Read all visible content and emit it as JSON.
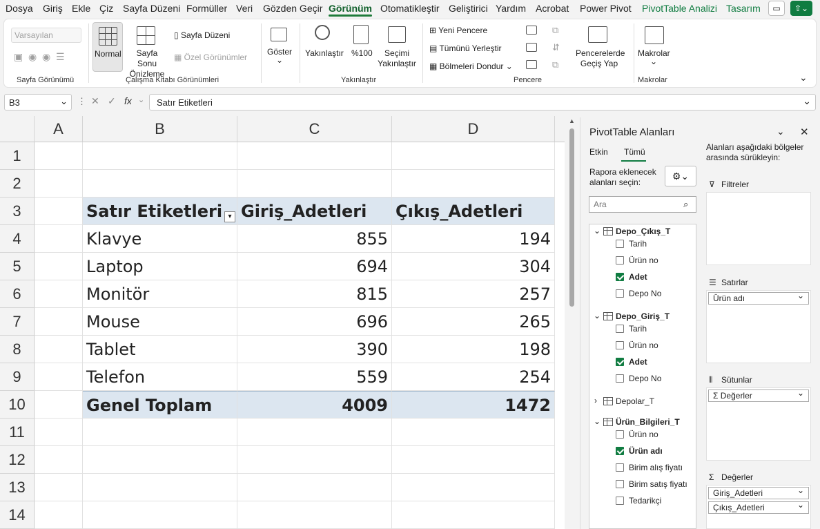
{
  "menu": {
    "tabs": [
      "Dosya",
      "Giriş",
      "Ekle",
      "Çiz",
      "Sayfa Düzeni",
      "Formüller",
      "Veri",
      "Gözden Geçir",
      "Görünüm",
      "Otomatikleştir",
      "Geliştirici",
      "Yardım",
      "Acrobat",
      "Power Pivot",
      "PivotTable Analizi",
      "Tasarım"
    ],
    "active": "Görünüm"
  },
  "ribbon": {
    "sheet_view": {
      "dropdown": "Varsayılan",
      "label": "Sayfa Görünümü"
    },
    "workbook_views": {
      "normal": "Normal",
      "page_break": "Sayfa Sonu Önizleme",
      "page_layout": "Sayfa Düzeni",
      "custom": "Özel Görünümler",
      "label": "Çalışma Kitabı Görünümleri"
    },
    "show": {
      "label": "Göster"
    },
    "zoom": {
      "zoom": "Yakınlaştır",
      "hundred": "%100",
      "selection": "Seçimi Yakınlaştır",
      "label": "Yakınlaştır"
    },
    "window": {
      "new": "Yeni Pencere",
      "arrange": "Tümünü Yerleştir",
      "freeze": "Bölmeleri Dondur",
      "switch": "Pencerelerde Geçiş Yap",
      "label": "Pencere"
    },
    "macros": {
      "label": "Makrolar",
      "button": "Makrolar"
    }
  },
  "formula_bar": {
    "name_box": "B3",
    "formula": "Satır Etiketleri"
  },
  "sheet": {
    "columns": [
      "A",
      "B",
      "C",
      "D"
    ],
    "rows": [
      "1",
      "2",
      "3",
      "4",
      "5",
      "6",
      "7",
      "8",
      "9",
      "10",
      "11",
      "12",
      "13",
      "14"
    ],
    "pivot": {
      "headers": [
        "Satır Etiketleri",
        "Giriş_Adetleri",
        "Çıkış_Adetleri"
      ],
      "items": [
        {
          "name": "Klavye",
          "in": "855",
          "out": "194"
        },
        {
          "name": "Laptop",
          "in": "694",
          "out": "304"
        },
        {
          "name": "Monitör",
          "in": "815",
          "out": "257"
        },
        {
          "name": "Mouse",
          "in": "696",
          "out": "265"
        },
        {
          "name": "Tablet",
          "in": "390",
          "out": "198"
        },
        {
          "name": "Telefon",
          "in": "559",
          "out": "254"
        }
      ],
      "total": {
        "name": "Genel Toplam",
        "in": "4009",
        "out": "1472"
      }
    }
  },
  "pane": {
    "title": "PivotTable Alanları",
    "tabs": [
      "Etkin",
      "Tümü"
    ],
    "choose_label": "Rapora eklenecek alanları seçin:",
    "search_placeholder": "Ara",
    "drag_label": "Alanları aşağıdaki bölgeler arasında sürükleyin:",
    "tables": [
      {
        "name": "Depo_Çıkış_T",
        "fields": [
          {
            "name": "Tarih",
            "checked": false
          },
          {
            "name": "Ürün no",
            "checked": false
          },
          {
            "name": "Adet",
            "checked": true
          },
          {
            "name": "Depo No",
            "checked": false
          }
        ]
      },
      {
        "name": "Depo_Giriş_T",
        "fields": [
          {
            "name": "Tarih",
            "checked": false
          },
          {
            "name": "Ürün no",
            "checked": false
          },
          {
            "name": "Adet",
            "checked": true
          },
          {
            "name": "Depo No",
            "checked": false
          }
        ]
      },
      {
        "name": "Depolar_T",
        "fields": []
      },
      {
        "name": "Ürün_Bilgileri_T",
        "fields": [
          {
            "name": "Ürün no",
            "checked": false
          },
          {
            "name": "Ürün adı",
            "checked": true
          },
          {
            "name": "Birim alış fiyatı",
            "checked": false
          },
          {
            "name": "Birim satış fiyatı",
            "checked": false
          },
          {
            "name": "Tedarikçi",
            "checked": false
          }
        ]
      }
    ],
    "areas": {
      "filters": "Filtreler",
      "rows": "Satırlar",
      "columns": "Sütunlar",
      "values": "Değerler"
    },
    "rows_items": [
      "Ürün adı"
    ],
    "columns_items": [
      "Σ Değerler"
    ],
    "values_items": [
      "Giriş_Adetleri",
      "Çıkış_Adetleri"
    ]
  }
}
